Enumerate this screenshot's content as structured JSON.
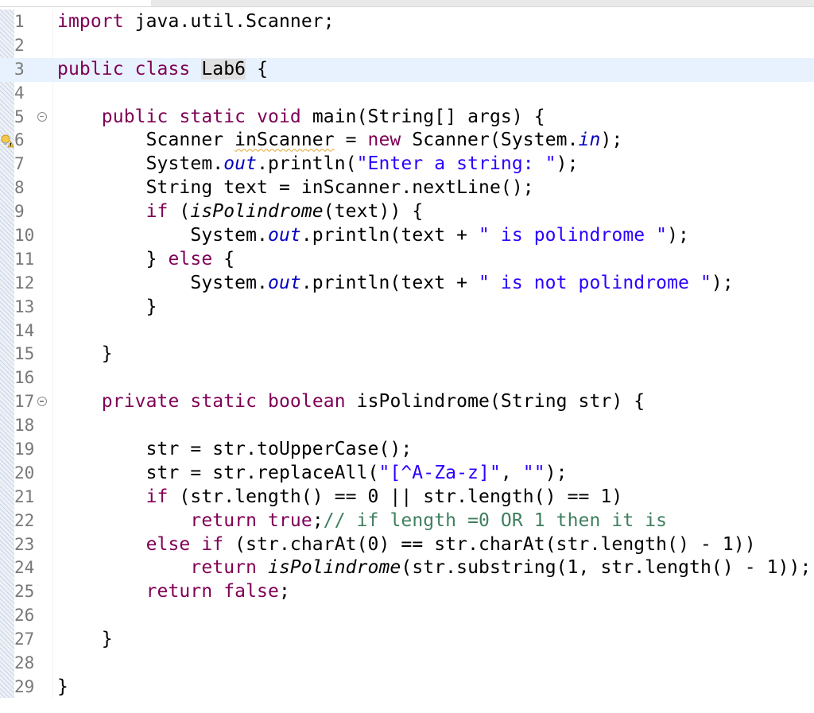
{
  "editor": {
    "warning_icon": "lightbulb-warning-icon",
    "fold_icon": "fold-collapse-icon",
    "colors": {
      "keyword": "#7f0055",
      "string": "#2a00ff",
      "field": "#0000c0",
      "comment": "#3f7f5f",
      "line_number": "#787878",
      "current_line": "#e8f2fe"
    }
  },
  "lines": [
    {
      "n": "1",
      "segs": [
        [
          "kw",
          "import"
        ],
        [
          "",
          "java.util.Scanner;"
        ]
      ]
    },
    {
      "n": "2",
      "segs": []
    },
    {
      "n": "3",
      "segs": [
        [
          "kw",
          "public"
        ],
        [
          "",
          " "
        ],
        [
          "kw",
          "class"
        ],
        [
          "",
          " "
        ],
        [
          "hl",
          "Lab6"
        ],
        [
          "",
          " {"
        ]
      ]
    },
    {
      "n": "4",
      "segs": []
    },
    {
      "n": "5",
      "segs": [
        [
          "",
          "    "
        ],
        [
          "kw",
          "public"
        ],
        [
          "",
          " "
        ],
        [
          "kw",
          "static"
        ],
        [
          "",
          " "
        ],
        [
          "kw",
          "void"
        ],
        [
          "",
          " main(String[] "
        ],
        [
          "",
          "args) {"
        ]
      ]
    },
    {
      "n": "6",
      "segs": [
        [
          "",
          "        Scanner "
        ],
        [
          "wavy",
          "inScanner"
        ],
        [
          "",
          " = "
        ],
        [
          "kw",
          "new"
        ],
        [
          "",
          " Scanner(System."
        ],
        [
          "fld",
          "in"
        ],
        [
          "",
          ");"
        ]
      ]
    },
    {
      "n": "7",
      "segs": [
        [
          "",
          "        System."
        ],
        [
          "fld",
          "out"
        ],
        [
          "",
          ".println("
        ],
        [
          "str",
          "\"Enter a string: \""
        ],
        [
          "",
          ");"
        ]
      ]
    },
    {
      "n": "8",
      "segs": [
        [
          "",
          "        String text = inScanner.nextLine();"
        ]
      ]
    },
    {
      "n": "9",
      "segs": [
        [
          "",
          "        "
        ],
        [
          "kw",
          "if"
        ],
        [
          "",
          " ("
        ],
        [
          "it",
          "isPolindrome"
        ],
        [
          "",
          "(text)) {"
        ]
      ]
    },
    {
      "n": "10",
      "segs": [
        [
          "",
          "            System."
        ],
        [
          "fld",
          "out"
        ],
        [
          "",
          ".println(text + "
        ],
        [
          "str",
          "\" is polindrome \""
        ],
        [
          "",
          ");"
        ]
      ]
    },
    {
      "n": "11",
      "segs": [
        [
          "",
          "        } "
        ],
        [
          "kw",
          "else"
        ],
        [
          "",
          " {"
        ]
      ]
    },
    {
      "n": "12",
      "segs": [
        [
          "",
          "            System."
        ],
        [
          "fld",
          "out"
        ],
        [
          "",
          ".println(text + "
        ],
        [
          "str",
          "\" is not polindrome \""
        ],
        [
          "",
          ");"
        ]
      ]
    },
    {
      "n": "13",
      "segs": [
        [
          "",
          "        }"
        ]
      ]
    },
    {
      "n": "14",
      "segs": []
    },
    {
      "n": "15",
      "segs": [
        [
          "",
          "    }"
        ]
      ]
    },
    {
      "n": "16",
      "segs": []
    },
    {
      "n": "17",
      "segs": [
        [
          "",
          "    "
        ],
        [
          "kw",
          "private"
        ],
        [
          "",
          " "
        ],
        [
          "kw",
          "static"
        ],
        [
          "",
          " "
        ],
        [
          "kw",
          "boolean"
        ],
        [
          "",
          " isPolindrome(String str) {"
        ]
      ]
    },
    {
      "n": "18",
      "segs": []
    },
    {
      "n": "19",
      "segs": [
        [
          "",
          "        str = str.toUpperCase();"
        ]
      ]
    },
    {
      "n": "20",
      "segs": [
        [
          "",
          "        str = str.replaceAll("
        ],
        [
          "str",
          "\"[^A-Za-z]\""
        ],
        [
          "",
          ", "
        ],
        [
          "str",
          "\"\""
        ],
        [
          "",
          ");"
        ]
      ]
    },
    {
      "n": "21",
      "segs": [
        [
          "",
          "        "
        ],
        [
          "kw",
          "if"
        ],
        [
          "",
          " (str.length() == 0 || str.length() == 1)"
        ]
      ]
    },
    {
      "n": "22",
      "segs": [
        [
          "",
          "            "
        ],
        [
          "kw",
          "return"
        ],
        [
          "",
          " "
        ],
        [
          "kw",
          "true"
        ],
        [
          "",
          ";"
        ],
        [
          "cm",
          "// if length =0 OR 1 then it is"
        ]
      ]
    },
    {
      "n": "23",
      "segs": [
        [
          "",
          "        "
        ],
        [
          "kw",
          "else"
        ],
        [
          "",
          " "
        ],
        [
          "kw",
          "if"
        ],
        [
          "",
          " (str.charAt(0) == str.charAt(str.length() - 1))"
        ]
      ]
    },
    {
      "n": "24",
      "segs": [
        [
          "",
          "            "
        ],
        [
          "kw",
          "return"
        ],
        [
          "",
          " "
        ],
        [
          "it",
          "isPolindrome"
        ],
        [
          "",
          "(str.substring(1, str.length() - 1));"
        ]
      ]
    },
    {
      "n": "25",
      "segs": [
        [
          "",
          "        "
        ],
        [
          "kw",
          "return"
        ],
        [
          "",
          " "
        ],
        [
          "kw",
          "false"
        ],
        [
          "",
          ";"
        ]
      ]
    },
    {
      "n": "26",
      "segs": []
    },
    {
      "n": "27",
      "segs": [
        [
          "",
          "    }"
        ]
      ]
    },
    {
      "n": "28",
      "segs": []
    },
    {
      "n": "29",
      "segs": [
        [
          "",
          "}"
        ]
      ]
    }
  ]
}
